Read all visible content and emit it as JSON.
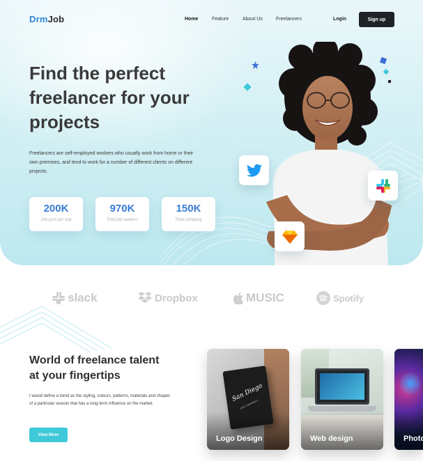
{
  "header": {
    "logo_part1": "Drm",
    "logo_part2": "Job",
    "nav": [
      {
        "label": "Home"
      },
      {
        "label": "Feature"
      },
      {
        "label": "About Us"
      },
      {
        "label": "Freelancers"
      }
    ],
    "login_label": "Login",
    "signup_label": "Sign up"
  },
  "hero": {
    "headline_line1": "Find the perfect",
    "headline_line2": "freelancer for your",
    "headline_line3": "projects",
    "description": "Freelancers are self-employed workers who usually work from home or their own premises, and tend to work for a number of different clients on different projects.",
    "stats": [
      {
        "value": "200K",
        "label": "Job post per day"
      },
      {
        "value": "970K",
        "label": "Total job seekers"
      },
      {
        "value": "150K",
        "label": "Total company"
      }
    ],
    "app_icons": [
      "twitter-icon",
      "slack-icon",
      "sketch-icon"
    ]
  },
  "brands": [
    {
      "name": "slack",
      "icon": "slack-logo-icon"
    },
    {
      "name": "Dropbox",
      "icon": "dropbox-logo-icon"
    },
    {
      "name": "MUSIC",
      "icon": "apple-logo-icon"
    },
    {
      "name": "Spotify",
      "icon": "spotify-logo-icon"
    }
  ],
  "talent": {
    "title_line1": "World of freelance talent",
    "title_line2": "at your fingertips",
    "text": "I would define a trend as the styling, colours, patterns, materials and shapes of a particular season that has a long-term influence on the market.",
    "button_label": "View More",
    "cards": [
      {
        "label": "Logo Design",
        "sign_text_main": "San Diego",
        "sign_text_sub": "STATE UNIVERSITY"
      },
      {
        "label": "Web design"
      },
      {
        "label": "Photo"
      }
    ]
  },
  "colors": {
    "accent": "#3fc8d8",
    "brand_blue": "#2f86d8",
    "stat_blue": "#3a7bd5",
    "dark_button": "#202326"
  }
}
